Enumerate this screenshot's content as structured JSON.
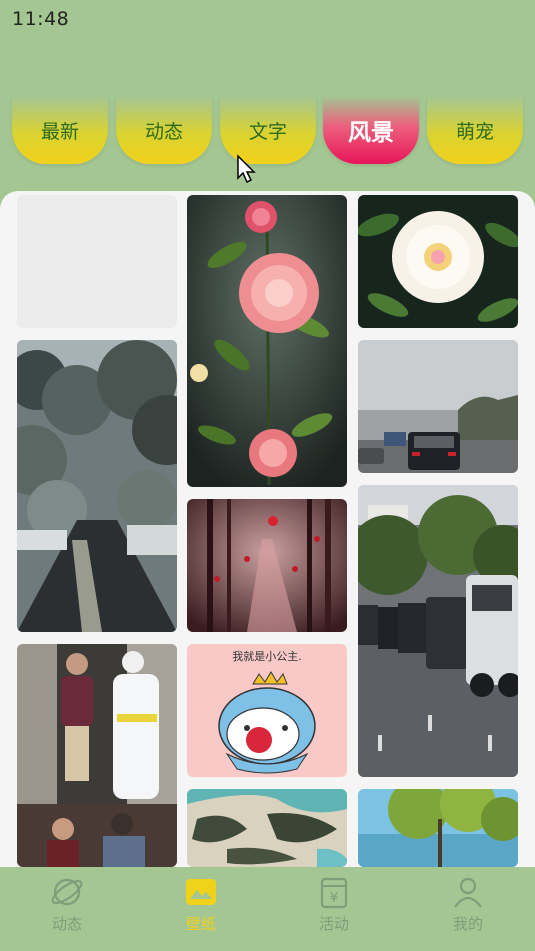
{
  "status": {
    "time": "11:48"
  },
  "tabs": [
    {
      "label": "最新"
    },
    {
      "label": "动态"
    },
    {
      "label": "文字"
    },
    {
      "label": "风景",
      "active": true
    },
    {
      "label": "萌宠"
    }
  ],
  "sticker": {
    "caption": "我就是小公主."
  },
  "bottom_nav": [
    {
      "label": "动态",
      "icon": "planet-icon"
    },
    {
      "label": "壁纸",
      "icon": "wallpaper-icon",
      "active": true
    },
    {
      "label": "活动",
      "icon": "calendar-icon"
    },
    {
      "label": "我的",
      "icon": "profile-icon"
    }
  ],
  "colors": {
    "background": "#a3c693",
    "tab_yellow": "#f3d21c",
    "tab_active": "#e8155a",
    "nav_active": "#f1d21b",
    "nav_inactive": "#7f9d79"
  }
}
